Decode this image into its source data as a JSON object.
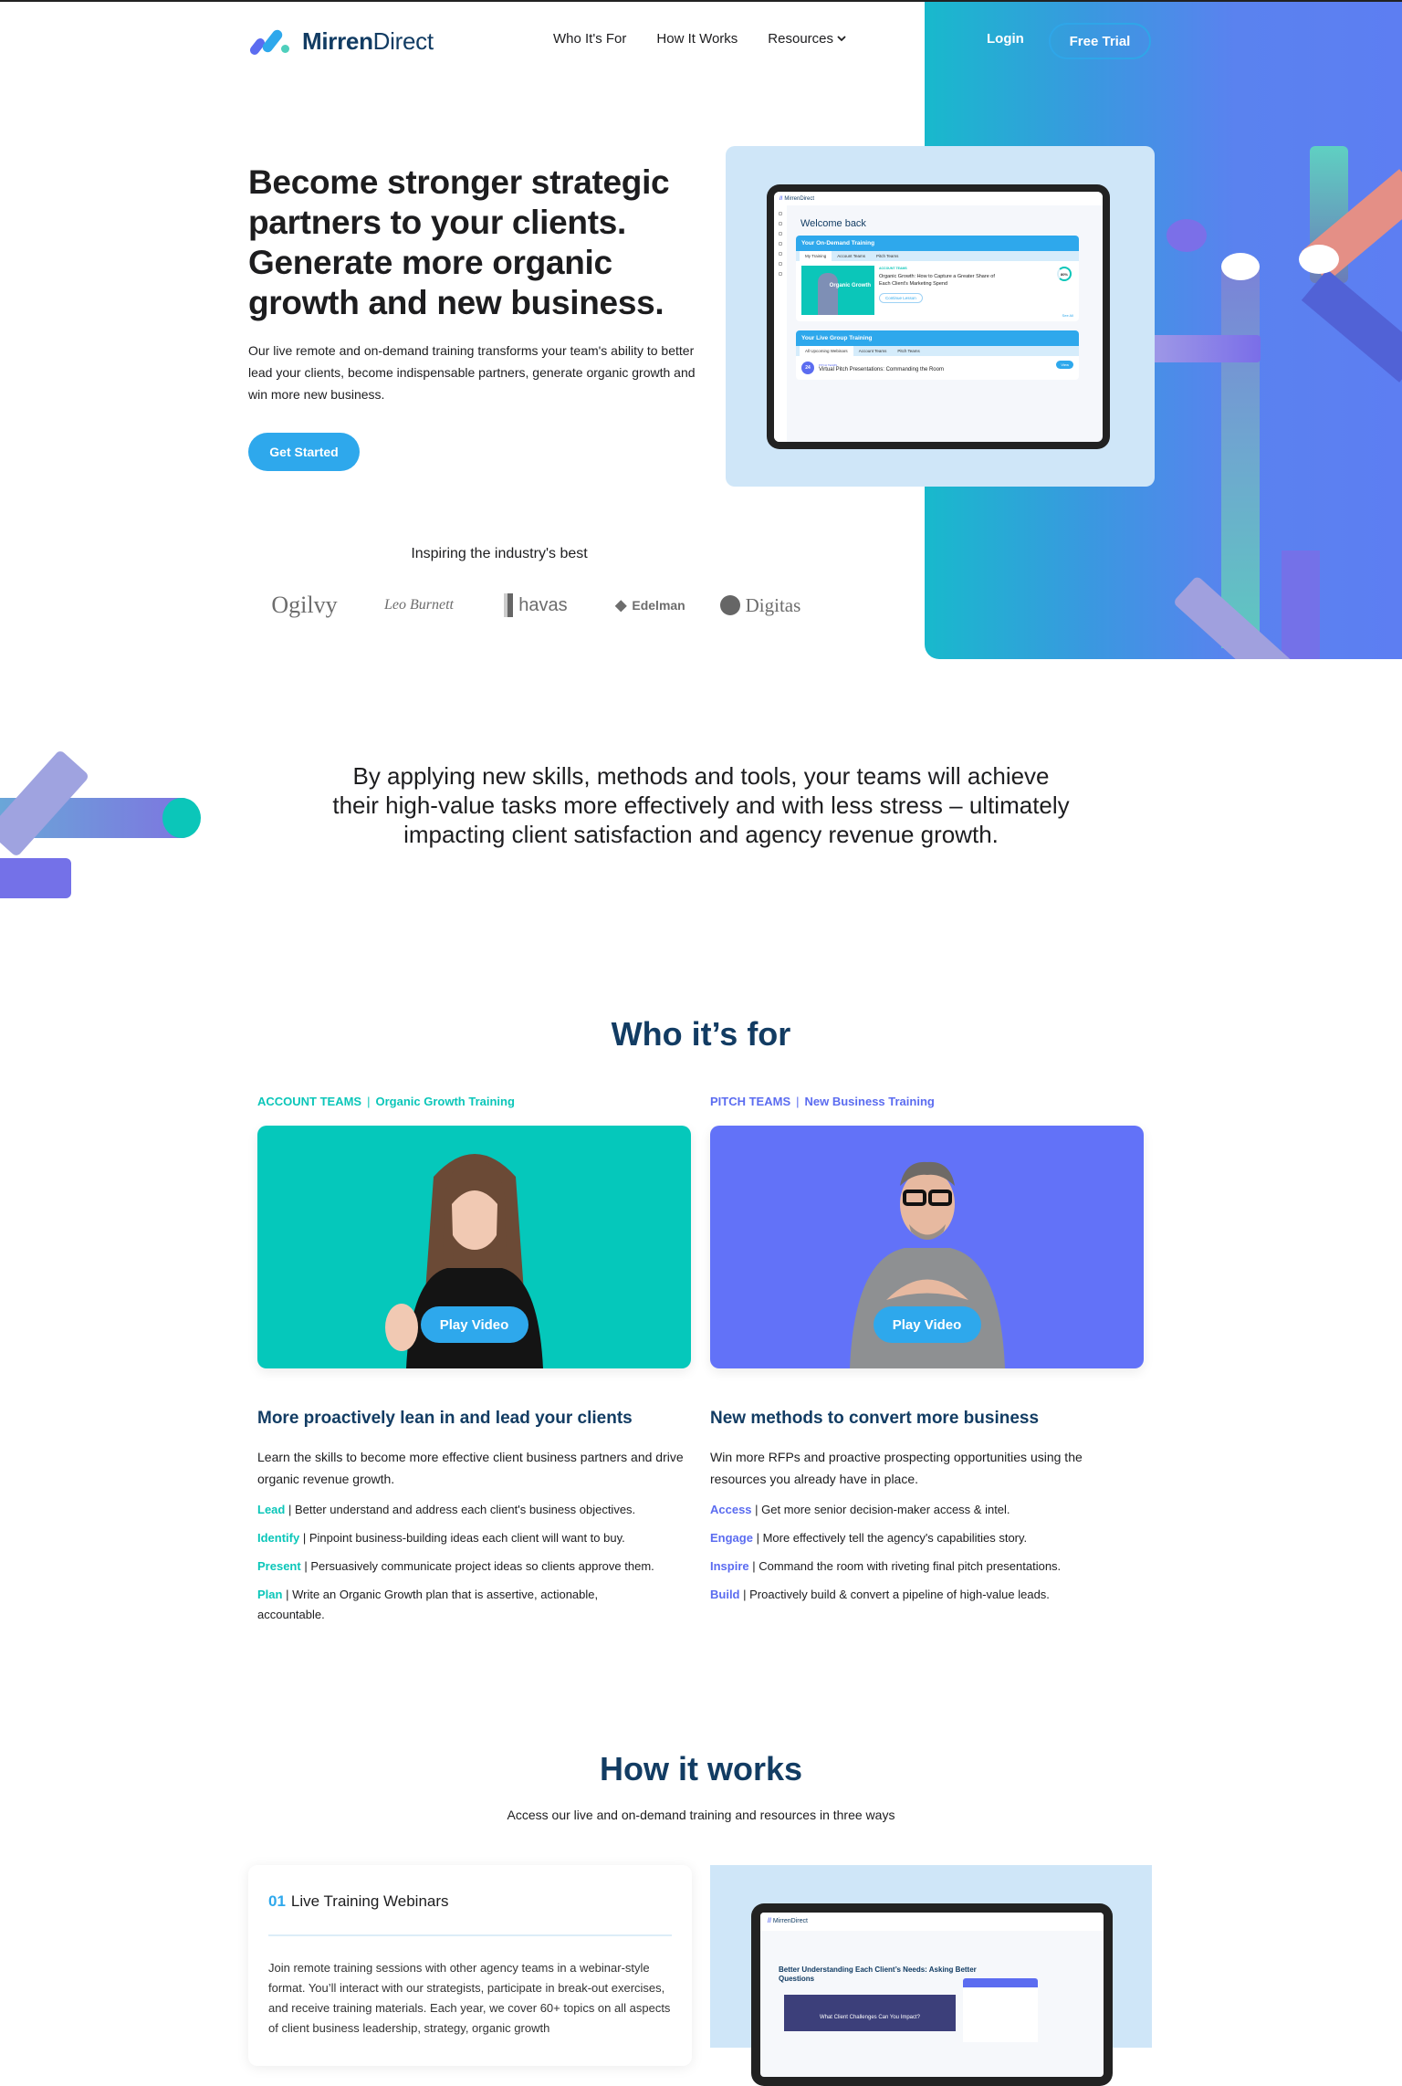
{
  "brand": {
    "name_bold": "Mirren",
    "name_light": "Direct"
  },
  "nav": {
    "items": [
      {
        "label": "Who It's For"
      },
      {
        "label": "How It Works"
      },
      {
        "label": "Resources",
        "has_dropdown": true
      }
    ],
    "login": "Login",
    "free_trial": "Free Trial"
  },
  "hero": {
    "title": "Become stronger strategic partners to your clients. Generate more organic growth and new business.",
    "subtitle": "Our live remote and on-demand training transforms your team's ability to better lead your clients, become indispensable partners, generate organic growth and win more new business.",
    "cta": "Get Started"
  },
  "dashboard": {
    "brand": "MirrenDirect",
    "welcome": "Welcome back",
    "on_demand": {
      "header": "Your On-Demand Training",
      "tabs": [
        "My Training",
        "Account Teams",
        "Pitch Teams"
      ],
      "active_tab": "My Training",
      "thumb_label": "Organic Growth",
      "tag": "ACCOUNT TEAMS",
      "title": "Organic Growth: How to Capture a Greater Share of Each Client's Marketing Spend",
      "progress": "80%",
      "button": "Continue Lesson",
      "see_all": "See All"
    },
    "live": {
      "header": "Your Live Group Training",
      "tabs": [
        "All Upcoming Webinars",
        "Account Teams",
        "Pitch Teams"
      ],
      "active_tab": "All Upcoming Webinars",
      "date_day": "24",
      "date_month": "Mar",
      "tag": "PITCH TEAMS",
      "title": "Virtual Pitch Presentations: Commanding the Room",
      "button": "View"
    }
  },
  "partners": {
    "heading": "Inspiring the industry's best",
    "logos": [
      "Ogilvy",
      "Leo Burnett",
      "havas",
      "Edelman",
      "Digitas"
    ]
  },
  "statement": "By applying new skills, methods and tools, your teams will achieve their high-value tasks more effectively and with less stress – ultimately impacting client satisfaction and agency revenue growth.",
  "who": {
    "heading": "Who it’s for",
    "columns": [
      {
        "eyebrow_team": "ACCOUNT TEAMS",
        "eyebrow_training": "Organic Growth Training",
        "play": "Play Video",
        "title": "More proactively lean in and lead your clients",
        "description": "Learn the skills to become more effective client business partners and drive organic revenue growth.",
        "bullets": [
          {
            "key": "Lead",
            "text": "Better understand and address each client's business objectives."
          },
          {
            "key": "Identify",
            "text": "Pinpoint business-building ideas each client will want to buy."
          },
          {
            "key": "Present",
            "text": "Persuasively communicate project ideas so clients approve them."
          },
          {
            "key": "Plan",
            "text": "Write an Organic Growth plan that is assertive, actionable, accountable."
          }
        ],
        "accent": "#0bc6b9"
      },
      {
        "eyebrow_team": "PITCH TEAMS",
        "eyebrow_training": "New Business Training",
        "play": "Play Video",
        "title": "New methods to convert more business",
        "description": "Win more RFPs and proactive prospecting opportunities using the resources you already have in place.",
        "bullets": [
          {
            "key": "Access",
            "text": "Get more senior decision-maker access & intel."
          },
          {
            "key": "Engage",
            "text": "More effectively tell the agency's capabilities story."
          },
          {
            "key": "Inspire",
            "text": "Command the room with riveting final pitch presentations."
          },
          {
            "key": "Build",
            "text": "Proactively build & convert a pipeline of high-value leads."
          }
        ],
        "accent": "#5b6cf0"
      }
    ]
  },
  "how": {
    "heading": "How it works",
    "subheading": "Access our live and on-demand training and resources in three ways",
    "step": {
      "number": "01",
      "title": "Live Training Webinars",
      "description": "Join remote training sessions with other agency teams in a webinar-style format. You’ll interact with our strategists, participate in break-out exercises, and receive training materials. Each year, we cover 60+ topics on all aspects of client business leadership, strategy, organic growth"
    },
    "preview": {
      "brand": "MirrenDirect",
      "title": "Better Understanding Each Client’s Needs: Asking Better Questions",
      "video_caption": "What Client Challenges Can You Impact?"
    }
  },
  "colors": {
    "primary": "#2ea8ec",
    "navy": "#123c63",
    "teal": "#0bc6b9",
    "indigo": "#5b6cf0"
  }
}
